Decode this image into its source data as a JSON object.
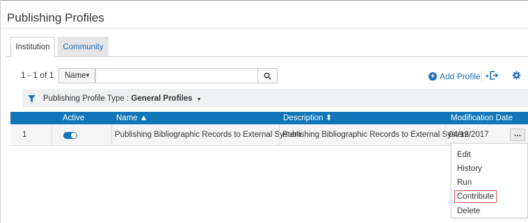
{
  "page": {
    "title": "Publishing Profiles"
  },
  "tabs": [
    {
      "label": "Institution",
      "active": true
    },
    {
      "label": "Community",
      "active": false
    }
  ],
  "toolbar": {
    "count": "1 - 1 of 1",
    "field_select": "Name",
    "search_value": "",
    "add_profile_label": "Add Profile"
  },
  "filter": {
    "label": "Publishing Profile Type : ",
    "value": "General Profiles"
  },
  "table": {
    "headers": {
      "active": "Active",
      "name": "Name ▲",
      "description": "Description ⬍",
      "modification_date": "Modification Date"
    },
    "rows": [
      {
        "index": "1",
        "active": true,
        "name": "Publishing Bibliographic Records to External System",
        "description": "Publishing Bibliographic Records to External System",
        "modification_date": "04/12/2017",
        "actions_label": "..."
      }
    ]
  },
  "row_menu": {
    "items": [
      "Edit",
      "History",
      "Run",
      "Contribute",
      "Delete"
    ],
    "highlighted": "Contribute"
  },
  "colors": {
    "accent": "#1175b9",
    "link": "#1a6fb5",
    "highlight_border": "#e04646"
  }
}
